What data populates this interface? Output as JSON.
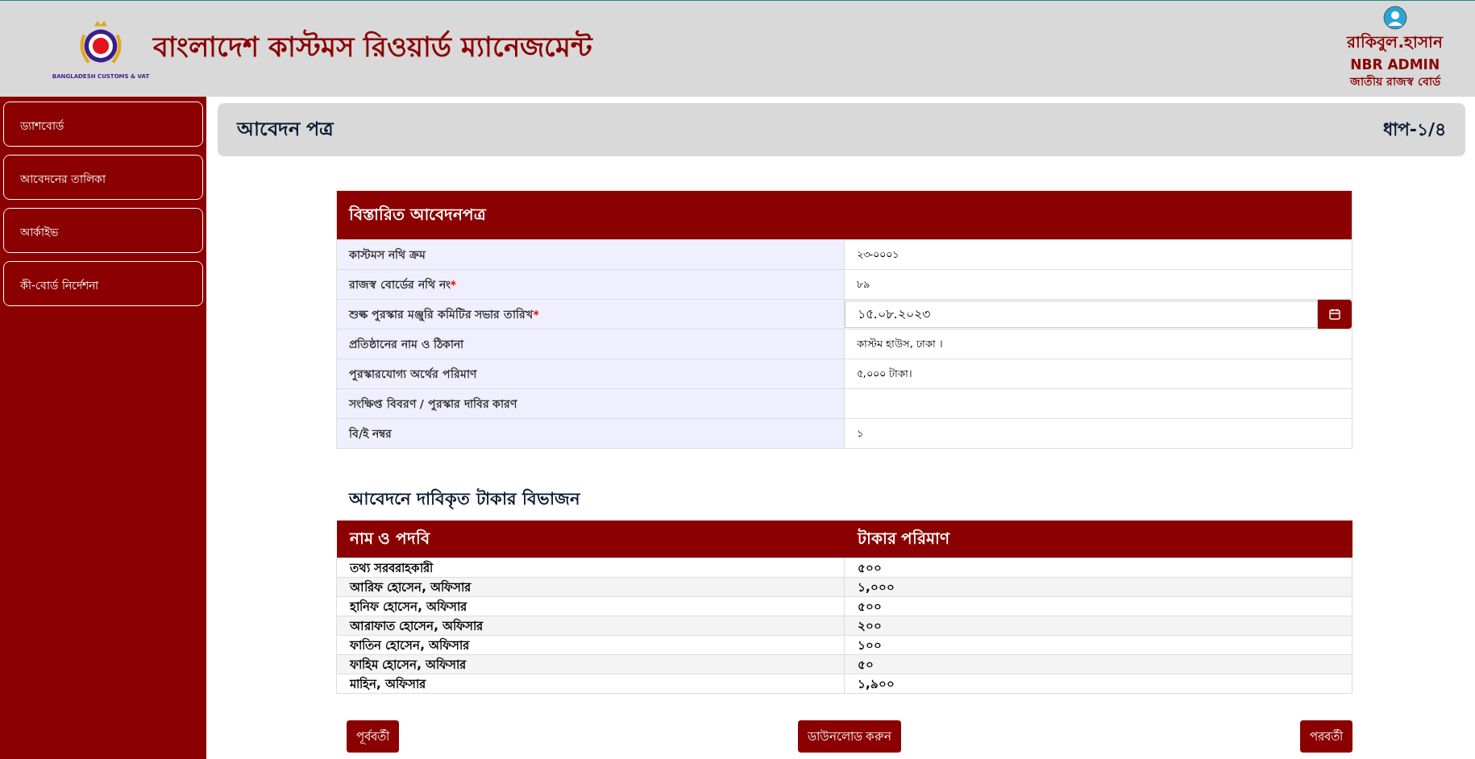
{
  "header": {
    "title": "বাংলাদেশ কাস্টমস রিওয়ার্ড ম্যানেজমেন্ট",
    "logo_caption": "BANGLADESH CUSTOMS & VAT",
    "user": {
      "name": "রাকিবুল.হাসান",
      "role": "NBR ADMIN",
      "office": "জাতীয় রাজস্ব বোর্ড"
    }
  },
  "sidebar": {
    "items": [
      {
        "label": "ড্যাশবোর্ড",
        "selected": false
      },
      {
        "label": "আবেদনের তালিকা",
        "selected": false
      },
      {
        "label": "আর্কাইভ",
        "selected": false
      },
      {
        "label": "কী-বোর্ড নির্দেশনা",
        "selected": false
      }
    ]
  },
  "page_header": {
    "title": "আবেদন পত্র",
    "step": "ধাপ-১/৪"
  },
  "details": {
    "title": "বিস্তারিত আবেদনপত্র",
    "rows": [
      {
        "label": "কাস্টমস নথি ক্রম",
        "kind": "text",
        "value": "২৩-০০০১"
      },
      {
        "label": "রাজস্ব বোর্ডের নথি নং",
        "required_mark": "*",
        "kind": "text",
        "value": "৮৯"
      },
      {
        "label": "শুল্ক পুরস্কার মঞ্জুরি কমিটির সভার তারিখ",
        "required_mark": "*",
        "kind": "date",
        "value": "১৫.০৮.২০২৩"
      },
      {
        "label": "প্রতিষ্ঠানের নাম ও ঠিকানা",
        "kind": "text",
        "value": "কাস্টম হাউস, ঢাকা ।"
      },
      {
        "label": "পুরস্কারযোগ্য অর্থের পরিমাণ",
        "kind": "text",
        "value": "৫,০০০ টাকা।"
      },
      {
        "label": "সংক্ষিপ্ত বিবরণ / পুরস্কার দাবির কারণ",
        "kind": "text"
      },
      {
        "label": "বি/ই নম্বর",
        "kind": "text",
        "value": "১"
      }
    ]
  },
  "breakdown": {
    "title": "আবেদনে দাবিকৃত টাকার বিভাজন",
    "columns": [
      "নাম ও পদবি",
      "টাকার পরিমাণ"
    ],
    "rows": [
      [
        "তথ্য সরবরাহকারী",
        "৫০০"
      ],
      [
        "আরিফ হোসেন, অফিসার",
        "১,০০০"
      ],
      [
        "হানিফ হোসেন, অফিসার",
        "৫০০"
      ],
      [
        "আরাফাত হোসেন, অফিসার",
        "২০০"
      ],
      [
        "ফাতিন হোসেন, অফিসার",
        "১০০"
      ],
      [
        "ফাহিম হোসেন, অফিসার",
        "৫০"
      ],
      [
        "মাহিন, অফিসার",
        "১,৯০০"
      ]
    ]
  },
  "footer": {
    "buttons": [
      "পূর্ববর্তী",
      "ডাউনলোড করুন",
      "পরবর্তী"
    ]
  }
}
